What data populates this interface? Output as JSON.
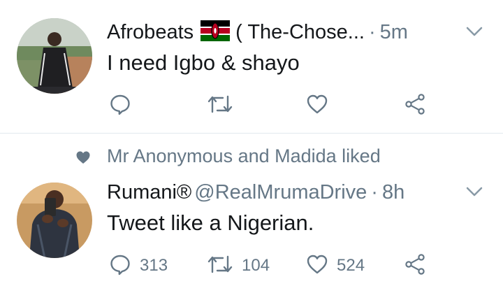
{
  "tweets": [
    {
      "name": "Afrobeats 🇰🇪 ( The-Chose...",
      "name_before_flag": "Afrobeats",
      "name_after_flag": "( The-Chose...",
      "flag": "kenya-flag-icon",
      "dot": "·",
      "time": "5m",
      "text": "I need Igbo & shayo",
      "counts": {
        "reply": "",
        "retweet": "",
        "like": ""
      }
    },
    {
      "social_context": "Mr Anonymous and Madida liked",
      "name": "Rumani®",
      "handle": "@RealMrumaDrive",
      "dot": "·",
      "time": "8h",
      "text": "Tweet like a Nigerian.",
      "counts": {
        "reply": "313",
        "retweet": "104",
        "like": "524"
      }
    }
  ],
  "icons": [
    "chevron-down-icon",
    "reply-icon",
    "retweet-icon",
    "like-icon",
    "share-icon",
    "heart-icon",
    "kenya-flag-icon"
  ],
  "colors": {
    "icon_gray": "#657786",
    "text_dark": "#14171a",
    "divider": "#e1e8ed"
  }
}
